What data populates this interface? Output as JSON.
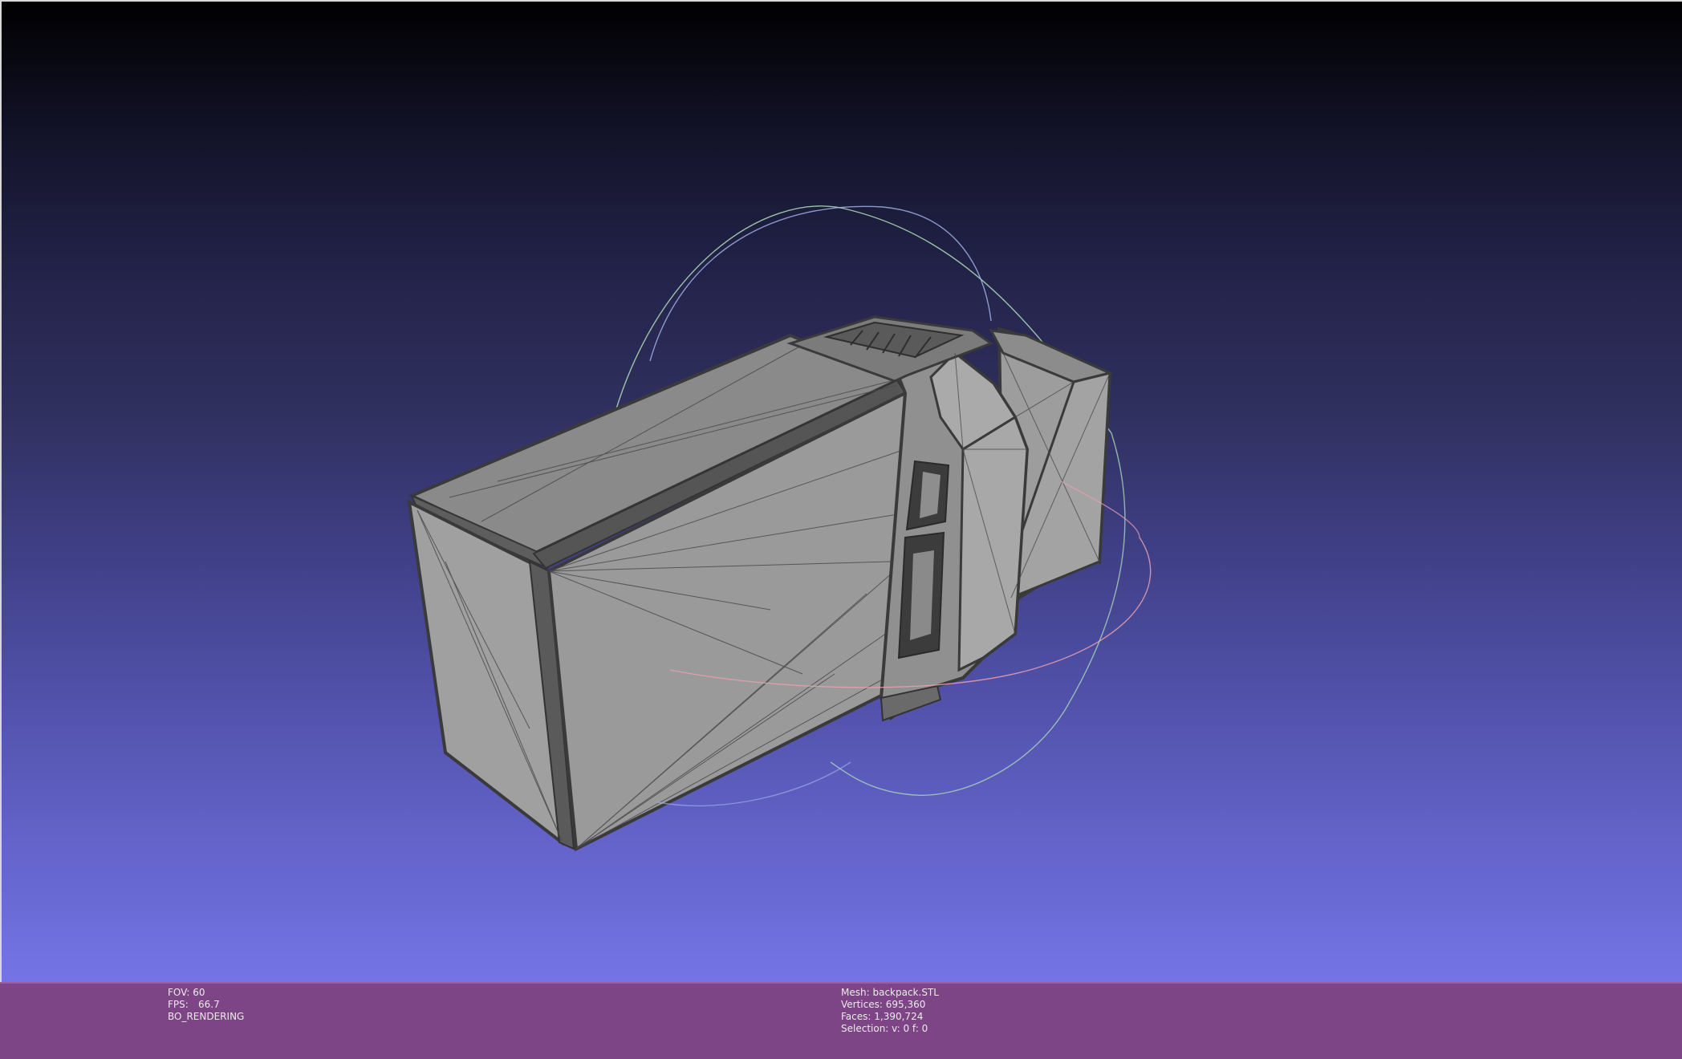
{
  "viewport": {
    "background_top": "#000000",
    "background_bottom": "#7474e6",
    "mesh_color": "#9b9b9b",
    "edge_color": "#3a3a3a"
  },
  "status_left": {
    "fov_label": "FOV:",
    "fov_value": "60",
    "fps_label": "FPS:",
    "fps_value": "66.7",
    "render_mode": "BO_RENDERING"
  },
  "status_right": {
    "mesh_label": "Mesh:",
    "mesh_value": "backpack.STL",
    "vertices_label": "Vertices:",
    "vertices_value": "695,360",
    "faces_label": "Faces:",
    "faces_value": "1,390,724",
    "selection_label": "Selection:",
    "selection_value": "v: 0 f: 0"
  },
  "infobar": {
    "background": "#7d4585"
  }
}
